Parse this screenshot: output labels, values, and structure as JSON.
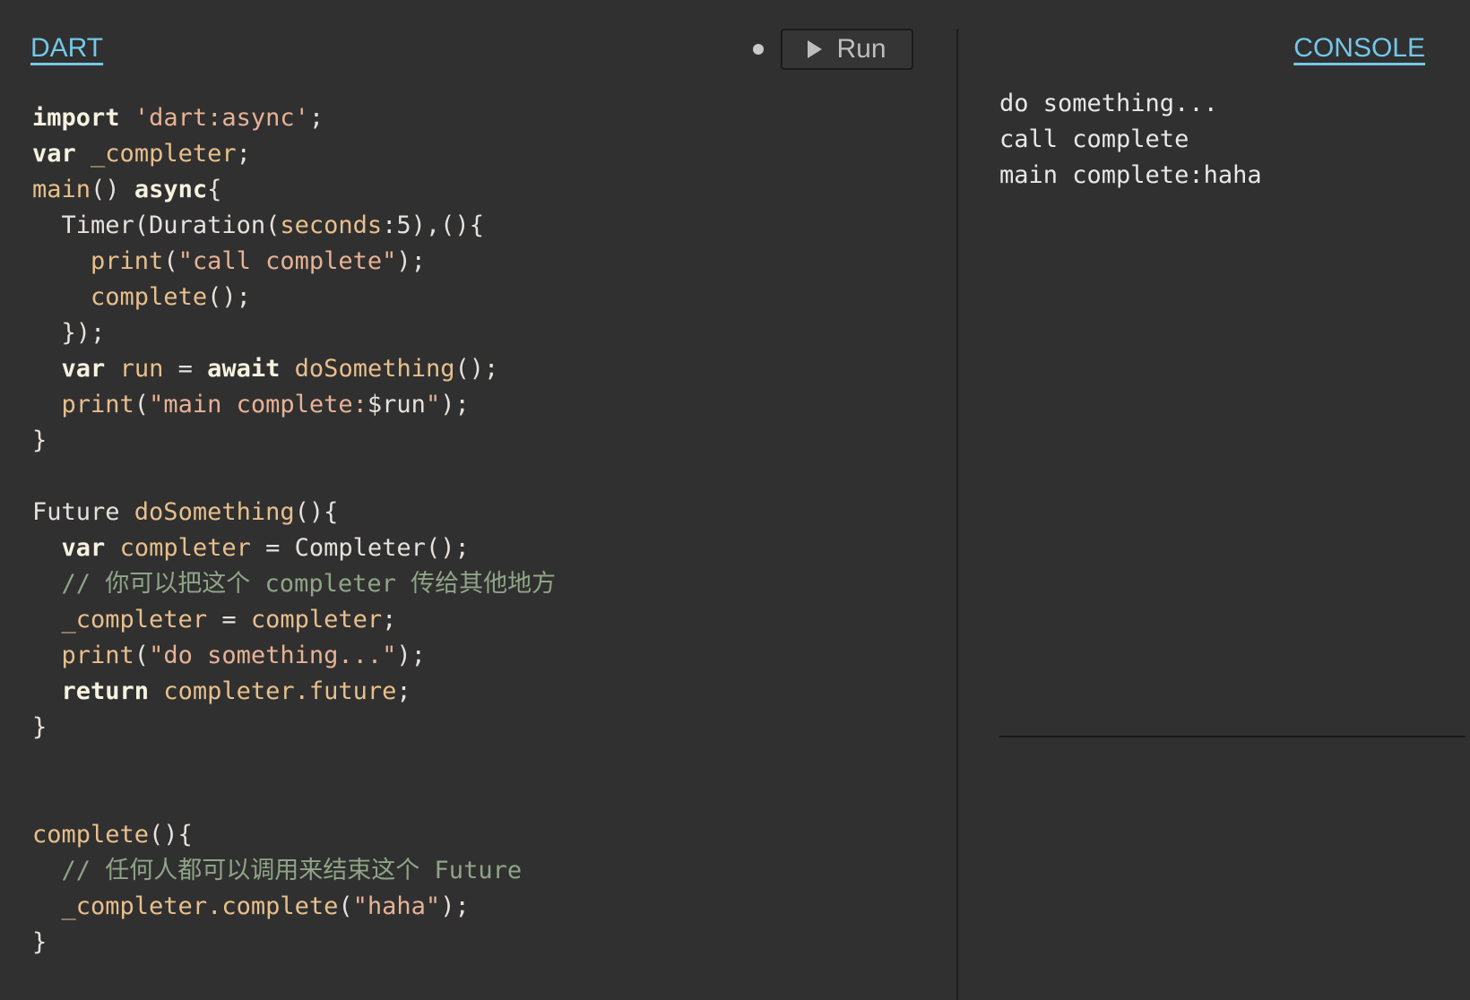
{
  "editor": {
    "tab_label": "DART",
    "run_label": "Run",
    "code_lines": [
      {
        "indent": 0,
        "tokens": [
          {
            "t": "import",
            "c": "k"
          },
          {
            "t": " "
          },
          {
            "t": "'dart:async'",
            "c": "s"
          },
          {
            "t": ";"
          }
        ]
      },
      {
        "indent": 0,
        "tokens": [
          {
            "t": "var",
            "c": "k"
          },
          {
            "t": " "
          },
          {
            "t": "_completer",
            "c": "f"
          },
          {
            "t": ";"
          }
        ]
      },
      {
        "indent": 0,
        "tokens": [
          {
            "t": "main",
            "c": "f"
          },
          {
            "t": "() "
          },
          {
            "t": "async",
            "c": "k"
          },
          {
            "t": "{"
          }
        ]
      },
      {
        "indent": 1,
        "tokens": [
          {
            "t": "Timer(Duration("
          },
          {
            "t": "seconds",
            "c": "f"
          },
          {
            "t": ":5),(){"
          }
        ]
      },
      {
        "indent": 2,
        "tokens": [
          {
            "t": "print",
            "c": "f"
          },
          {
            "t": "("
          },
          {
            "t": "\"call complete\"",
            "c": "s"
          },
          {
            "t": ");"
          }
        ]
      },
      {
        "indent": 2,
        "tokens": [
          {
            "t": "complete",
            "c": "f"
          },
          {
            "t": "();"
          }
        ]
      },
      {
        "indent": 1,
        "tokens": [
          {
            "t": "});"
          }
        ]
      },
      {
        "indent": 1,
        "tokens": [
          {
            "t": "var",
            "c": "k"
          },
          {
            "t": " "
          },
          {
            "t": "run",
            "c": "f"
          },
          {
            "t": " = "
          },
          {
            "t": "await",
            "c": "k"
          },
          {
            "t": " "
          },
          {
            "t": "doSomething",
            "c": "f"
          },
          {
            "t": "();"
          }
        ]
      },
      {
        "indent": 1,
        "tokens": [
          {
            "t": "print",
            "c": "f"
          },
          {
            "t": "("
          },
          {
            "t": "\"main complete:",
            "c": "s"
          },
          {
            "t": "$run"
          },
          {
            "t": "\"",
            "c": "s"
          },
          {
            "t": ");"
          }
        ]
      },
      {
        "indent": 0,
        "tokens": [
          {
            "t": "}"
          }
        ]
      },
      {
        "indent": 0,
        "tokens": []
      },
      {
        "indent": 0,
        "tokens": [
          {
            "t": "Future "
          },
          {
            "t": "doSomething",
            "c": "f"
          },
          {
            "t": "(){"
          }
        ]
      },
      {
        "indent": 1,
        "tokens": [
          {
            "t": "var",
            "c": "k"
          },
          {
            "t": " "
          },
          {
            "t": "completer",
            "c": "f"
          },
          {
            "t": " = Completer();"
          }
        ]
      },
      {
        "indent": 1,
        "tokens": [
          {
            "t": "// ",
            "c": "c"
          },
          {
            "t": "你可以把这个",
            "c": "c cjk"
          },
          {
            "t": " completer ",
            "c": "c"
          },
          {
            "t": "传给其他地方",
            "c": "c cjk"
          }
        ]
      },
      {
        "indent": 1,
        "tokens": [
          {
            "t": "_completer",
            "c": "f"
          },
          {
            "t": " = "
          },
          {
            "t": "completer",
            "c": "f"
          },
          {
            "t": ";"
          }
        ]
      },
      {
        "indent": 1,
        "tokens": [
          {
            "t": "print",
            "c": "f"
          },
          {
            "t": "("
          },
          {
            "t": "\"do something...\"",
            "c": "s"
          },
          {
            "t": ");"
          }
        ]
      },
      {
        "indent": 1,
        "tokens": [
          {
            "t": "return",
            "c": "k"
          },
          {
            "t": " "
          },
          {
            "t": "completer.future",
            "c": "f"
          },
          {
            "t": ";"
          }
        ]
      },
      {
        "indent": 0,
        "tokens": [
          {
            "t": "}"
          }
        ]
      },
      {
        "indent": 0,
        "tokens": []
      },
      {
        "indent": 0,
        "tokens": []
      },
      {
        "indent": 0,
        "tokens": [
          {
            "t": "complete",
            "c": "f"
          },
          {
            "t": "(){"
          }
        ]
      },
      {
        "indent": 1,
        "tokens": [
          {
            "t": "// ",
            "c": "c"
          },
          {
            "t": "任何人都可以调用来结束这个",
            "c": "c cjk"
          },
          {
            "t": " Future",
            "c": "c"
          }
        ]
      },
      {
        "indent": 1,
        "tokens": [
          {
            "t": "_completer.complete",
            "c": "f"
          },
          {
            "t": "("
          },
          {
            "t": "\"haha\"",
            "c": "s"
          },
          {
            "t": ");"
          }
        ]
      },
      {
        "indent": 0,
        "tokens": [
          {
            "t": "}"
          }
        ]
      }
    ]
  },
  "console": {
    "tab_label": "CONSOLE",
    "lines": [
      "do something...",
      "call complete",
      "main complete:haha"
    ]
  },
  "colors": {
    "background": "#303030",
    "accent": "#74c7e8",
    "keyword": "#f6f2e0",
    "string": "#e7b295",
    "identifier": "#e8bf8c",
    "comment": "#90a487"
  }
}
